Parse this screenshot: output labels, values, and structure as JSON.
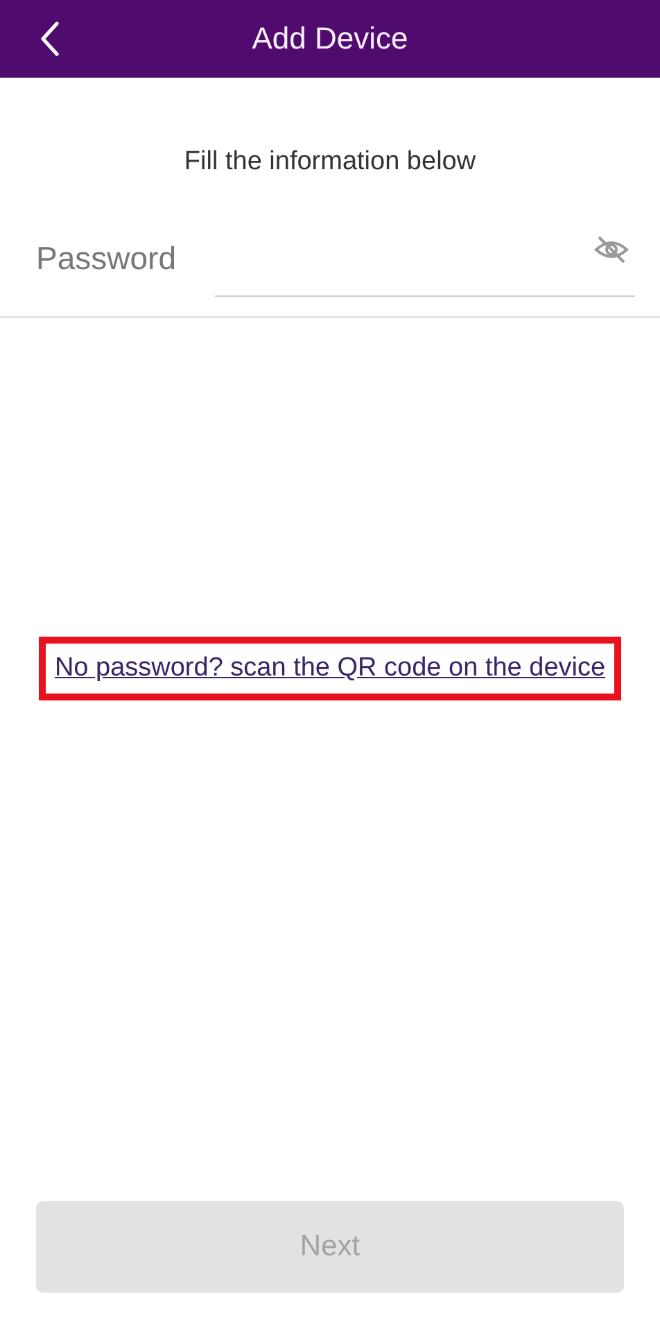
{
  "header": {
    "title": "Add Device"
  },
  "subtitle": "Fill the information below",
  "password": {
    "placeholder": "Password",
    "hidden": true
  },
  "qr_link": {
    "text": "No password? scan the QR code on the device",
    "highlighted": true
  },
  "next_button": {
    "label": "Next",
    "disabled": true
  }
}
